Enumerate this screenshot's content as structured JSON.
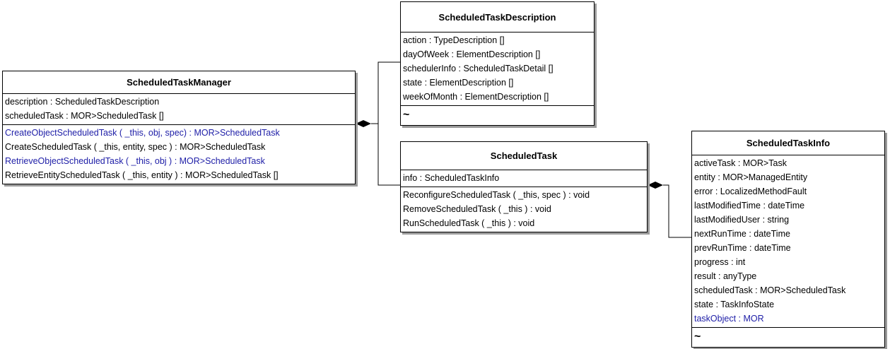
{
  "classes": {
    "manager": {
      "title": "ScheduledTaskManager",
      "attributes": [
        {
          "text": "description : ScheduledTaskDescription",
          "highlight": false
        },
        {
          "text": "scheduledTask : MOR>ScheduledTask []",
          "highlight": false
        }
      ],
      "methods": [
        {
          "text": "CreateObjectScheduledTask ( _this, obj, spec) : MOR>ScheduledTask",
          "highlight": true
        },
        {
          "text": "CreateScheduledTask ( _this, entity, spec ) : MOR>ScheduledTask",
          "highlight": false
        },
        {
          "text": "RetrieveObjectScheduledTask ( _this, obj ) : MOR>ScheduledTask",
          "highlight": true
        },
        {
          "text": "RetrieveEntityScheduledTask ( _this, entity ) : MOR>ScheduledTask []",
          "highlight": false
        }
      ]
    },
    "description": {
      "title": "ScheduledTaskDescription",
      "attributes": [
        {
          "text": "action : TypeDescription []",
          "highlight": false
        },
        {
          "text": "dayOfWeek : ElementDescription []",
          "highlight": false
        },
        {
          "text": "schedulerInfo : ScheduledTaskDetail []",
          "highlight": false
        },
        {
          "text": "state : ElementDescription []",
          "highlight": false
        },
        {
          "text": "weekOfMonth : ElementDescription []",
          "highlight": false
        }
      ],
      "footer": "~"
    },
    "task": {
      "title": "ScheduledTask",
      "attributes": [
        {
          "text": "info : ScheduledTaskInfo",
          "highlight": false
        }
      ],
      "methods": [
        {
          "text": "ReconfigureScheduledTask ( _this, spec ) : void",
          "highlight": false
        },
        {
          "text": "RemoveScheduledTask ( _this ) : void",
          "highlight": false
        },
        {
          "text": "RunScheduledTask ( _this ) : void",
          "highlight": false
        }
      ]
    },
    "info": {
      "title": "ScheduledTaskInfo",
      "attributes": [
        {
          "text": "activeTask : MOR>Task",
          "highlight": false
        },
        {
          "text": "entity : MOR>ManagedEntity",
          "highlight": false
        },
        {
          "text": "error : LocalizedMethodFault",
          "highlight": false
        },
        {
          "text": "lastModifiedTime : dateTime",
          "highlight": false
        },
        {
          "text": "lastModifiedUser : string",
          "highlight": false
        },
        {
          "text": "nextRunTime : dateTime",
          "highlight": false
        },
        {
          "text": "prevRunTime : dateTime",
          "highlight": false
        },
        {
          "text": "progress : int",
          "highlight": false
        },
        {
          "text": "result : anyType",
          "highlight": false
        },
        {
          "text": "scheduledTask : MOR>ScheduledTask",
          "highlight": false
        },
        {
          "text": "state : TaskInfoState",
          "highlight": false
        },
        {
          "text": "taskObject : MOR",
          "highlight": true
        }
      ],
      "footer": "~"
    }
  },
  "colors": {
    "border": "#000000",
    "highlight_text": "#2020a8",
    "shadow": "#9a9a9a"
  }
}
